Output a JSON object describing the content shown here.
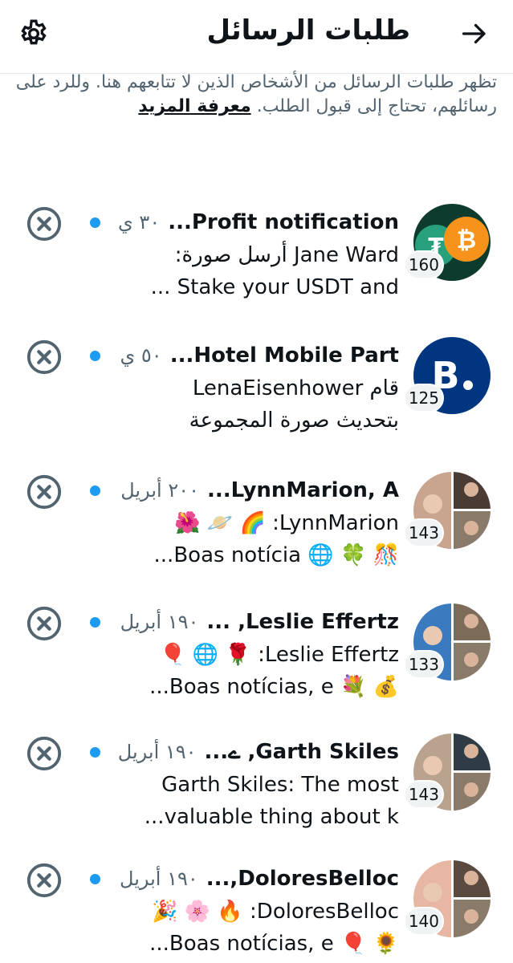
{
  "header": {
    "title": "طلبات الرسائل",
    "back_icon": "arrow-right-icon",
    "settings_icon": "gear-icon"
  },
  "info": {
    "text": "تظهر طلبات الرسائل من الأشخاص الذين لا تتابعهم هنا. وللرد على رسائلهم، تحتاج إلى قبول الطلب.",
    "learn_more": "معرفة المزيد"
  },
  "colors": {
    "unread_dot": "#1d9bf0",
    "secondary_text": "#536471"
  },
  "requests": [
    {
      "name": "Profit notification...",
      "time": "٣٠ ي",
      "line1": "Jane Ward أرسل صورة:",
      "line2": "Stake your USDT and ...",
      "count": "160"
    },
    {
      "name": "Hotel Mobile Part...",
      "time": "٥٠ ي",
      "line1": "قام LenaEisenhower",
      "line2": "بتحديث صورة المجموعة",
      "count": "125"
    },
    {
      "name": "LynnMarion, A...",
      "time": "٢٠٠ أبريل",
      "line1": "LynnMarion: 🌈 🪐 🌺",
      "line2": "🎊 🍀 🌐 Boas notícia...",
      "count": "143"
    },
    {
      "name": "Leslie Effertz, ...",
      "time": "١٩٠ أبريل",
      "line1": "Leslie Effertz: 🌹 🌐 🎈",
      "line2": "💰 💐 Boas notícias, e...",
      "count": "133"
    },
    {
      "name": "Garth Skiles, ے...",
      "time": "١٩٠ أبريل",
      "line1": "Garth Skiles: The most",
      "line2": "valuable thing about k...",
      "count": "143"
    },
    {
      "name": "DoloresBelloc,...",
      "time": "١٩٠ أبريل",
      "line1": "DoloresBelloc: 🔥 🌸 🎉",
      "line2": "🌻 🎈 Boas notícias, e...",
      "count": "140"
    }
  ]
}
